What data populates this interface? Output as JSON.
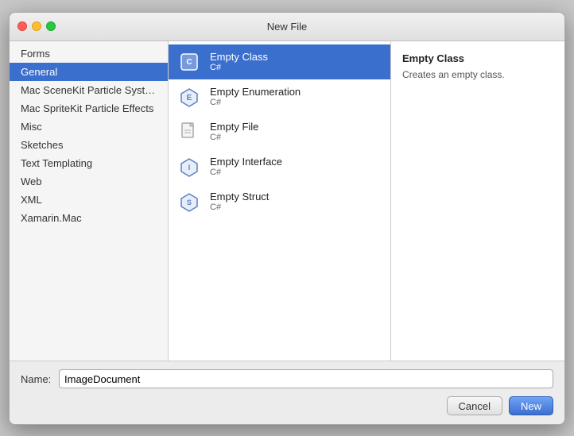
{
  "window": {
    "title": "New File"
  },
  "titlebar": {
    "title": "New File"
  },
  "sidebar": {
    "items": [
      {
        "id": "forms",
        "label": "Forms"
      },
      {
        "id": "general",
        "label": "General",
        "active": true
      },
      {
        "id": "mac-scenekit",
        "label": "Mac SceneKit Particle System"
      },
      {
        "id": "mac-spritekit",
        "label": "Mac SpriteKit Particle Effects"
      },
      {
        "id": "misc",
        "label": "Misc"
      },
      {
        "id": "sketches",
        "label": "Sketches"
      },
      {
        "id": "text-templating",
        "label": "Text Templating"
      },
      {
        "id": "web",
        "label": "Web"
      },
      {
        "id": "xml",
        "label": "XML"
      },
      {
        "id": "xamarin-mac",
        "label": "Xamarin.Mac"
      }
    ]
  },
  "list": {
    "items": [
      {
        "id": "empty-class",
        "name": "Empty Class",
        "sub": "C#",
        "active": true,
        "icon": "class"
      },
      {
        "id": "empty-enumeration",
        "name": "Empty Enumeration",
        "sub": "C#",
        "icon": "enum"
      },
      {
        "id": "empty-file",
        "name": "Empty File",
        "sub": "C#",
        "icon": "file"
      },
      {
        "id": "empty-interface",
        "name": "Empty Interface",
        "sub": "C#",
        "icon": "interface"
      },
      {
        "id": "empty-struct",
        "name": "Empty Struct",
        "sub": "C#",
        "icon": "struct"
      }
    ]
  },
  "detail": {
    "title": "Empty Class",
    "description": "Creates an empty class."
  },
  "bottom": {
    "name_label": "Name:",
    "name_value": "ImageDocument",
    "name_placeholder": "",
    "cancel_label": "Cancel",
    "new_label": "New"
  }
}
